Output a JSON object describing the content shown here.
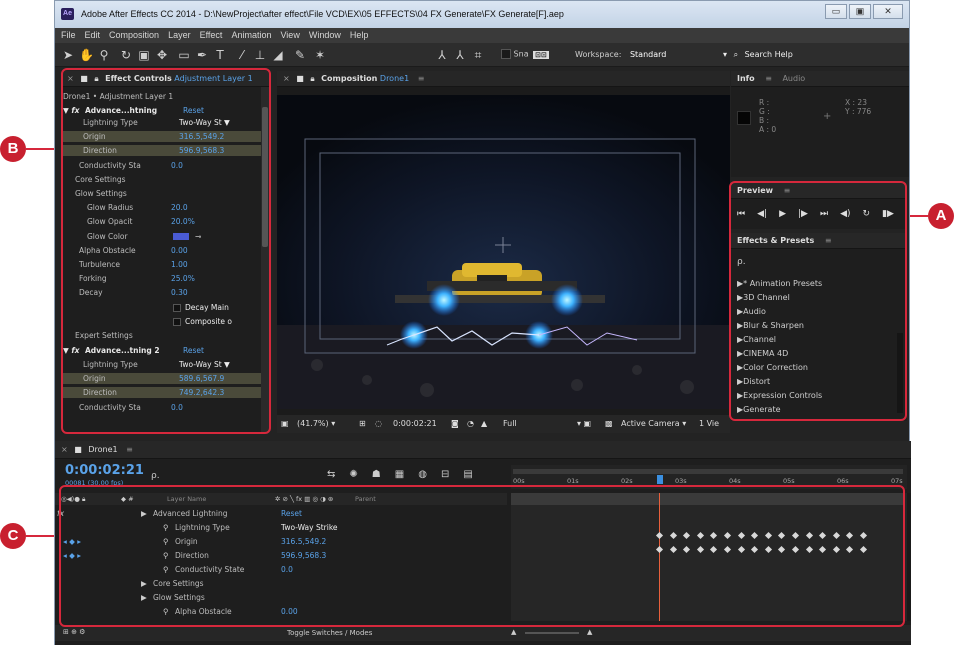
{
  "window": {
    "title": "Adobe After Effects CC 2014 - D:\\NewProject\\after effect\\File VCD\\EX\\05 EFFECTS\\04 FX Generate\\FX Generate[F].aep",
    "app_badge": "Ae",
    "buttons": {
      "minimize": "▭",
      "maximize": "▣",
      "close": "✕"
    }
  },
  "menu": [
    "File",
    "Edit",
    "Composition",
    "Layer",
    "Effect",
    "Animation",
    "View",
    "Window",
    "Help"
  ],
  "toolbar": {
    "snap_label": "Sna",
    "workspace_label": "Workspace:",
    "workspace_value": "Standard",
    "search_help": "Search Help"
  },
  "effect_controls": {
    "tab_title": "Effect Controls",
    "tab_layer": "Adjustment Layer 1",
    "breadcrumb": "Drone1 • Adjustment Layer 1",
    "effect1_name": "Advance...htning",
    "effect2_name": "Advance...tning 2",
    "reset": "Reset",
    "rows": [
      {
        "label": "Lightning Type",
        "value": "Two-Way St ▼",
        "white": true
      },
      {
        "label": "Origin",
        "value": "316.5,549.2",
        "hl": true
      },
      {
        "label": "Direction",
        "value": "596.9,568.3",
        "hl": true
      },
      {
        "label": "Conductivity Sta",
        "value": "0.0"
      },
      {
        "label": "Core Settings",
        "value": ""
      },
      {
        "label": "Glow Settings",
        "value": ""
      },
      {
        "label": "Glow Radius",
        "value": "20.0"
      },
      {
        "label": "Glow Opacit",
        "value": "20.0%"
      },
      {
        "label": "Glow Color",
        "value": ""
      },
      {
        "label": "Alpha Obstacle",
        "value": "0.00"
      },
      {
        "label": "Turbulence",
        "value": "1.00"
      },
      {
        "label": "Forking",
        "value": "25.0%"
      },
      {
        "label": "Decay",
        "value": "0.30"
      },
      {
        "label": "",
        "value": "Decay Main",
        "white": true
      },
      {
        "label": "",
        "value": "Composite o",
        "white": true
      },
      {
        "label": "Expert Settings",
        "value": ""
      }
    ],
    "rows2": [
      {
        "label": "Lightning Type",
        "value": "Two-Way St ▼",
        "white": true
      },
      {
        "label": "Origin",
        "value": "589.6,567.9",
        "hl": true
      },
      {
        "label": "Direction",
        "value": "749.2,642.3",
        "hl": true
      },
      {
        "label": "Conductivity Sta",
        "value": "0.0"
      }
    ]
  },
  "composition": {
    "tab_title": "Composition",
    "tab_name": "Drone1",
    "zoom": "(41.7%)",
    "timecode": "0:00:02:21",
    "resolution": "Full",
    "camera": "Active Camera",
    "views": "1 Vie"
  },
  "info": {
    "tab_info": "Info",
    "tab_audio": "Audio",
    "r": "R :",
    "g": "G :",
    "b": "B :",
    "a": "A : 0",
    "x": "X : 23",
    "y": "Y : 776"
  },
  "preview": {
    "title": "Preview"
  },
  "effects_presets": {
    "title": "Effects & Presets",
    "search_placeholder": "ρ.",
    "items": [
      "* Animation Presets",
      "3D Channel",
      "Audio",
      "Blur & Sharpen",
      "Channel",
      "CINEMA 4D",
      "Color Correction",
      "Distort",
      "Expression Controls",
      "Generate"
    ]
  },
  "timeline": {
    "tab_name": "Drone1",
    "timecode": "0:00:02:21",
    "frame_info": "00081 (30.00 fps)",
    "search_placeholder": "ρ.",
    "col_layer_name": "Layer Name",
    "col_parent": "Parent",
    "ruler": [
      "00s",
      "01s",
      "02s",
      "03s",
      "04s",
      "05s",
      "06s",
      "07s"
    ],
    "rows": [
      {
        "name": "Advanced Lightning",
        "value": "Reset",
        "indent": 1
      },
      {
        "name": "Lightning Type",
        "value": "Two-Way Strike",
        "indent": 2
      },
      {
        "name": "Origin",
        "value": "316.5,549.2",
        "indent": 2
      },
      {
        "name": "Direction",
        "value": "596.9,568.3",
        "indent": 2
      },
      {
        "name": "Conductivity State",
        "value": "0.0",
        "indent": 2
      },
      {
        "name": "Core Settings",
        "value": "",
        "indent": 1
      },
      {
        "name": "Glow Settings",
        "value": "",
        "indent": 1
      },
      {
        "name": "Alpha Obstacle",
        "value": "0.00",
        "indent": 2
      }
    ],
    "toggle_label": "Toggle Switches / Modes"
  },
  "callouts": {
    "a": "A",
    "b": "B",
    "c": "C"
  },
  "colors": {
    "accent_blue": "#5aa2e8",
    "callout_red": "#d6283c",
    "playhead": "#e8603c"
  }
}
